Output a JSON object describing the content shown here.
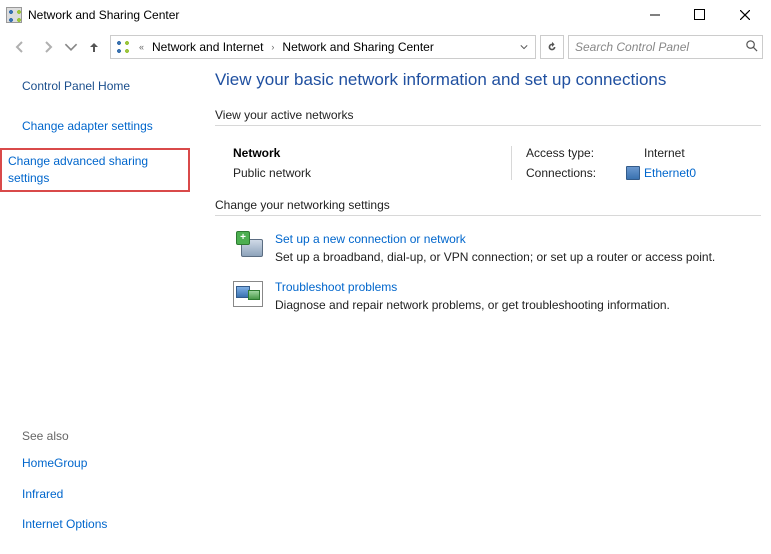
{
  "window": {
    "title": "Network and Sharing Center"
  },
  "nav": {
    "back_tip": "Back",
    "forward_tip": "Forward",
    "up_tip": "Up",
    "chev_left": "«",
    "path1": "Network and Internet",
    "sep": "›",
    "path2": "Network and Sharing Center",
    "refresh_tip": "Refresh",
    "search_placeholder": "Search Control Panel"
  },
  "sidebar": {
    "home": "Control Panel Home",
    "adapter": "Change adapter settings",
    "advanced": "Change advanced sharing settings",
    "see_also": "See also",
    "links": [
      "HomeGroup",
      "Infrared",
      "Internet Options"
    ]
  },
  "main": {
    "heading": "View your basic network information and set up connections",
    "active_hdr": "View your active networks",
    "network": {
      "name": "Network",
      "type": "Public network",
      "access_lbl": "Access type:",
      "access_val": "Internet",
      "conn_lbl": "Connections:",
      "conn_val": "Ethernet0"
    },
    "change_hdr": "Change your networking settings",
    "setup": {
      "title": "Set up a new connection or network",
      "desc": "Set up a broadband, dial-up, or VPN connection; or set up a router or access point."
    },
    "trouble": {
      "title": "Troubleshoot problems",
      "desc": "Diagnose and repair network problems, or get troubleshooting information."
    }
  }
}
